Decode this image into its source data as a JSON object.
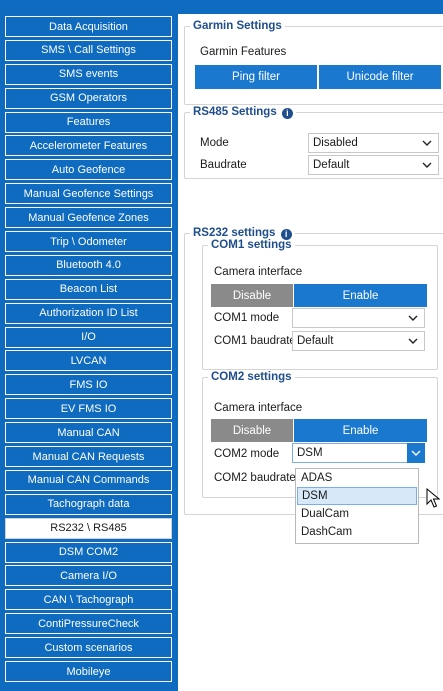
{
  "sidebar": {
    "items": [
      {
        "label": "Data Acquisition"
      },
      {
        "label": "SMS \\ Call Settings"
      },
      {
        "label": "SMS events"
      },
      {
        "label": "GSM Operators"
      },
      {
        "label": "Features"
      },
      {
        "label": "Accelerometer Features"
      },
      {
        "label": "Auto Geofence"
      },
      {
        "label": "Manual Geofence Settings"
      },
      {
        "label": "Manual Geofence Zones"
      },
      {
        "label": "Trip \\ Odometer"
      },
      {
        "label": "Bluetooth 4.0"
      },
      {
        "label": "Beacon List"
      },
      {
        "label": "Authorization ID List"
      },
      {
        "label": "I/O"
      },
      {
        "label": "LVCAN"
      },
      {
        "label": "FMS IO"
      },
      {
        "label": "EV FMS IO"
      },
      {
        "label": "Manual CAN"
      },
      {
        "label": "Manual CAN Requests"
      },
      {
        "label": "Manual CAN Commands"
      },
      {
        "label": "Tachograph data"
      },
      {
        "label": "RS232 \\ RS485",
        "active": true
      },
      {
        "label": "DSM COM2"
      },
      {
        "label": "Camera I/O"
      },
      {
        "label": "CAN \\ Tachograph"
      },
      {
        "label": "ContiPressureCheck"
      },
      {
        "label": "Custom scenarios"
      },
      {
        "label": "Mobileye"
      }
    ]
  },
  "garmin": {
    "title": "Garmin Settings",
    "features_label": "Garmin Features",
    "ping_filter": "Ping filter",
    "unicode_filter": "Unicode filter"
  },
  "rs485": {
    "title": "RS485 Settings",
    "mode_label": "Mode",
    "mode_value": "Disabled",
    "baudrate_label": "Baudrate",
    "baudrate_value": "Default"
  },
  "rs232": {
    "title": "RS232 settings",
    "com1": {
      "title": "COM1 settings",
      "camera_interface": "Camera interface",
      "disable": "Disable",
      "enable": "Enable",
      "mode_label": "COM1 mode",
      "mode_value": "",
      "baudrate_label": "COM1 baudrate",
      "baudrate_value": "Default"
    },
    "com2": {
      "title": "COM2 settings",
      "camera_interface": "Camera interface",
      "disable": "Disable",
      "enable": "Enable",
      "mode_label": "COM2 mode",
      "mode_value": "DSM",
      "baudrate_label": "COM2 baudrate",
      "mode_options": [
        "ADAS",
        "DSM",
        "DualCam",
        "DashCam"
      ],
      "selected_option": "DSM"
    }
  },
  "colors": {
    "sidebar_bg": "#0f6bbf",
    "accent_blue": "#1a78cf",
    "disabled_gray": "#8a8a8a",
    "group_title": "#1f4e8c"
  }
}
